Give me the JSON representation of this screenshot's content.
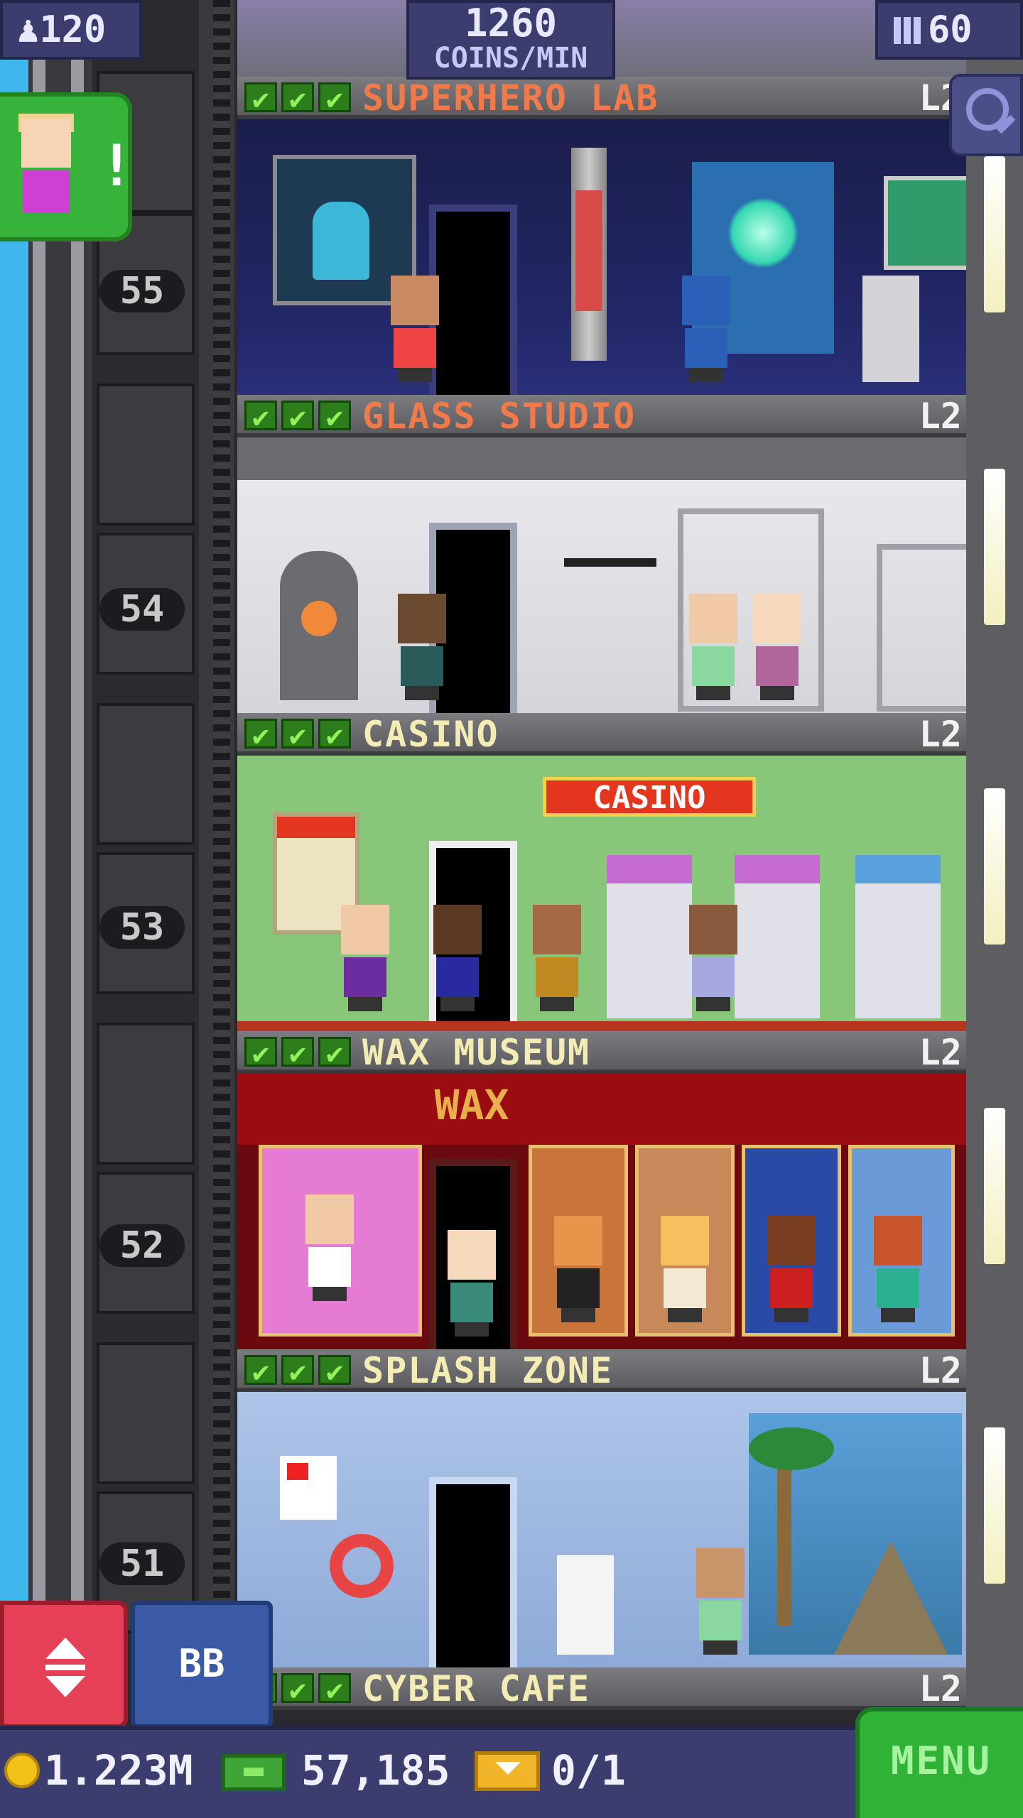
{
  "hud": {
    "population": "120",
    "coins_per_min_value": "1260",
    "coins_per_min_label": "COINS/MIN",
    "tower_bux": "60"
  },
  "shaft_floors": [
    "55",
    "54",
    "53",
    "52",
    "51"
  ],
  "floors": [
    {
      "name": "SUPERHERO LAB",
      "level": "L2",
      "name_color": "#f07a4a",
      "checks": 3
    },
    {
      "name": "GLASS STUDIO",
      "level": "L2",
      "name_color": "#f07a4a",
      "checks": 3
    },
    {
      "name": "CASINO",
      "level": "L2",
      "name_color": "#f3ecb4",
      "checks": 3
    },
    {
      "name": "WAX MUSEUM",
      "level": "L2",
      "name_color": "#f3ecb4",
      "checks": 3
    },
    {
      "name": "SPLASH ZONE",
      "level": "L2",
      "name_color": "#f3ecb4",
      "checks": 3
    },
    {
      "name": "CYBER CAFE",
      "level": "L2",
      "name_color": "#f3ecb4",
      "checks": 3
    }
  ],
  "signs": {
    "casino_sign": "CASINO",
    "wax_sign": "WAX"
  },
  "buttons": {
    "bb": "BB",
    "menu": "MENU"
  },
  "bottom": {
    "coins": "1.223M",
    "bux": "57,185",
    "tickets": "0/1"
  },
  "colors": {
    "hud_bg": "#3a3d6e",
    "check_green": "#8df55a",
    "menu_green": "#2fb236",
    "elevator_red": "#e64058",
    "bb_blue": "#3a5aa5"
  },
  "icons": [
    "population-icon",
    "tower-bux-icon",
    "zoom-icon",
    "coin-icon",
    "cash-icon",
    "ticket-icon",
    "elevator-updown-icon",
    "check-icon"
  ]
}
